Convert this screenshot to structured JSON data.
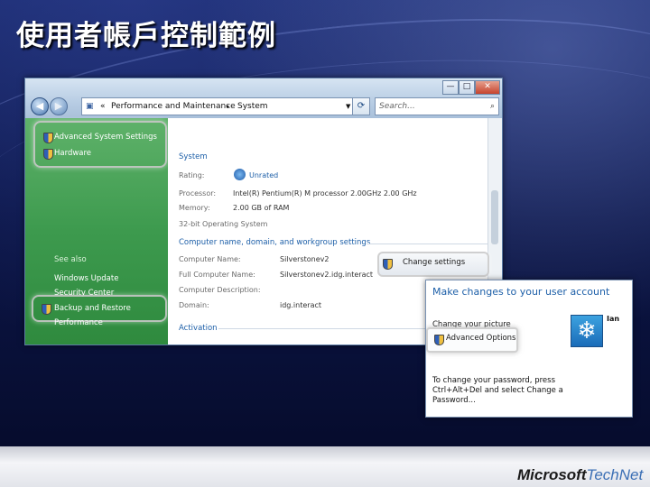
{
  "slide": {
    "title": "使用者帳戶控制範例",
    "brand": {
      "part1": "Microsoft",
      "part2": "TechNet"
    }
  },
  "window": {
    "controls": {
      "minimize": "—",
      "maximize": "□",
      "close": "✕"
    },
    "address": {
      "prefix": "«",
      "crumb1": "Performance and Maintenance",
      "separator": "▸",
      "crumb2": "System"
    },
    "search_placeholder": "Search...",
    "sidebar": {
      "tasks": [
        "Advanced System Settings",
        "Hardware"
      ],
      "see_also_heading": "See also",
      "see_also": [
        "Windows Update",
        "Security Center",
        "Backup and Restore",
        "Performance"
      ]
    },
    "system": {
      "heading": "System",
      "rating_label": "Rating:",
      "rating_value": "Unrated",
      "processor_label": "Processor:",
      "processor_value": "Intel(R) Pentium(R) M processor 2.00GHz   2.00 GHz",
      "memory_label": "Memory:",
      "memory_value": "2.00 GB of RAM",
      "os_label": "32-bit Operating System"
    },
    "computer_name": {
      "heading": "Computer name, domain, and workgroup settings",
      "name_label": "Computer Name:",
      "name_value": "Silverstonev2",
      "full_label": "Full Computer Name:",
      "full_value": "Silverstonev2.idg.interact",
      "desc_label": "Computer Description:",
      "domain_label": "Domain:",
      "domain_value": "idg.interact",
      "change_button": "Change settings"
    },
    "activation_heading": "Activation"
  },
  "account_panel": {
    "title": "Make changes to your user account",
    "change_picture": "Change your picture",
    "advanced_options": "Advanced Options",
    "user_name": "Ian",
    "password_hint": "To change your password, press Ctrl+Alt+Del and select Change a Password..."
  },
  "colors": {
    "accent_blue": "#1d5fa8",
    "sidebar_green": "#3d9a4e",
    "slide_background": "#0c1648"
  }
}
